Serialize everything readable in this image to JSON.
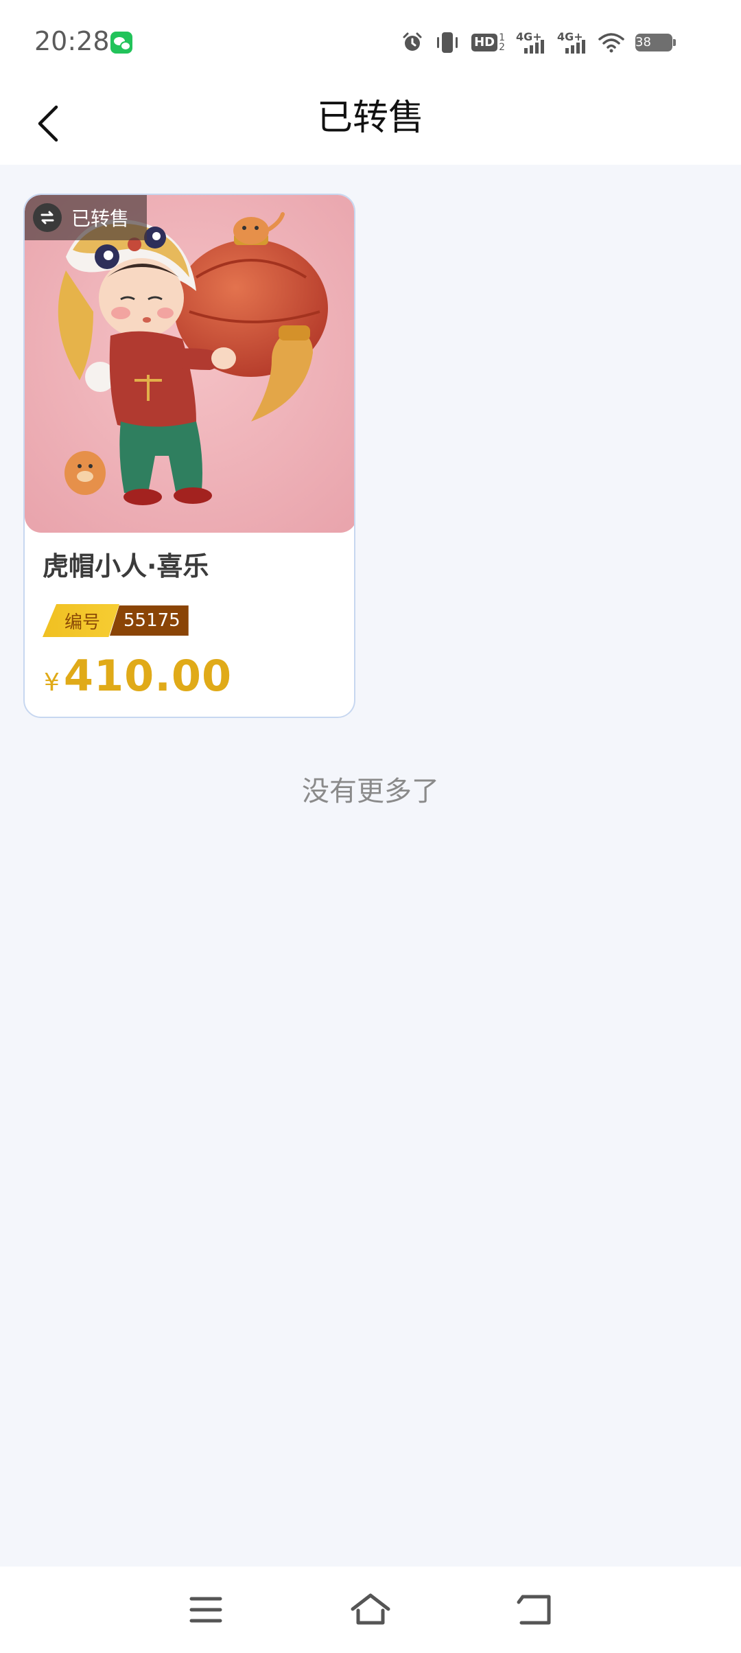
{
  "status_bar": {
    "time": "20:28",
    "hd_label": "HD",
    "hd_sub": "1\n2",
    "net1_label": "4G+",
    "net2_label": "4G+",
    "battery": "38"
  },
  "header": {
    "title": "已转售"
  },
  "items": [
    {
      "badge": "已转售",
      "title": "虎帽小人·喜乐",
      "serial_label": "编号",
      "serial_number": "55175",
      "currency": "¥",
      "price": "410.00"
    }
  ],
  "footer": {
    "no_more": "没有更多了"
  },
  "colors": {
    "accent_price": "#e0aa18",
    "serial_label_bg": "#f0c022",
    "serial_number_bg": "#8a4406",
    "card_border": "#c7d7f0",
    "page_bg": "#f4f6fb"
  },
  "icons": {
    "back": "chevron-left-icon",
    "badge": "swap-icon",
    "nav_menu": "menu-icon",
    "nav_home": "home-icon",
    "nav_back": "return-icon"
  }
}
